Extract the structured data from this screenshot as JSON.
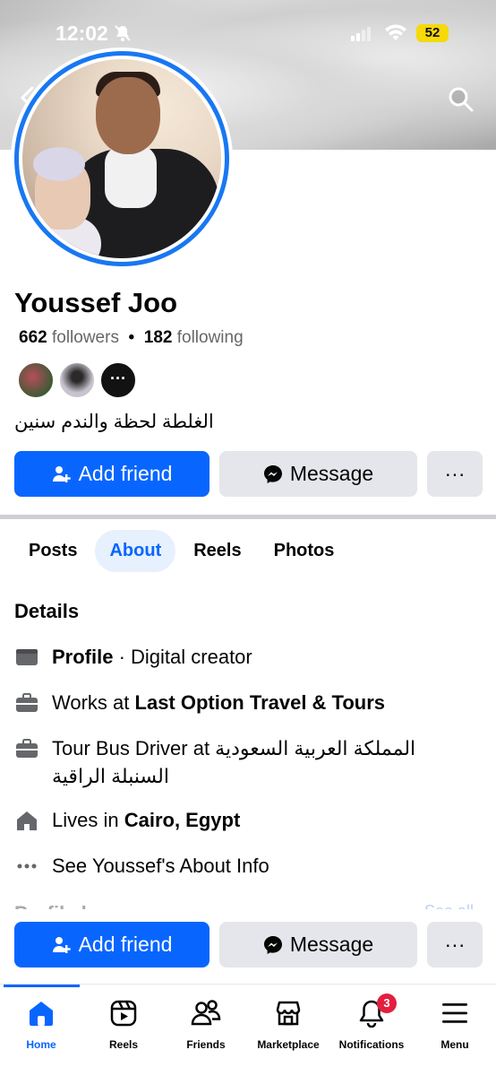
{
  "status_bar": {
    "time": "12:02",
    "battery": "52"
  },
  "profile": {
    "name": "Youssef Joo",
    "followers_count": "662",
    "followers_label": "followers",
    "following_count": "182",
    "following_label": "following",
    "separator": "•",
    "mutual_more": "···",
    "bio": "الغلطة لحظة والندم سنين"
  },
  "actions": {
    "add_friend": "Add friend",
    "message": "Message",
    "more": "···"
  },
  "tabs": [
    {
      "label": "Posts",
      "active": false
    },
    {
      "label": "About",
      "active": true
    },
    {
      "label": "Reels",
      "active": false
    },
    {
      "label": "Photos",
      "active": false
    }
  ],
  "details": {
    "title": "Details",
    "profile_label": "Profile",
    "profile_rest": " · Digital creator",
    "works_prefix": "Works at ",
    "works_place": "Last Option Travel & Tours",
    "job_line1": "Tour Bus Driver at المملكة العربية السعودية",
    "job_line2": "السنبلة الراقية",
    "lives_prefix": "Lives in ",
    "lives_place": "Cairo, Egypt",
    "see_about": "See Youssef's About Info"
  },
  "partial_section": {
    "title": "Profile l",
    "link": "See all"
  },
  "bottom_nav": [
    {
      "label": "Home",
      "icon": "home-icon",
      "active": true
    },
    {
      "label": "Reels",
      "icon": "reels-icon",
      "active": false
    },
    {
      "label": "Friends",
      "icon": "friends-icon",
      "active": false
    },
    {
      "label": "Marketplace",
      "icon": "marketplace-icon",
      "active": false
    },
    {
      "label": "Notifications",
      "icon": "bell-icon",
      "active": false,
      "badge": "3"
    },
    {
      "label": "Menu",
      "icon": "menu-icon",
      "active": false
    }
  ],
  "colors": {
    "accent": "#0866ff",
    "ring": "#1877f2",
    "secondary": "#e4e6eb",
    "badge": "#e41e3f"
  }
}
